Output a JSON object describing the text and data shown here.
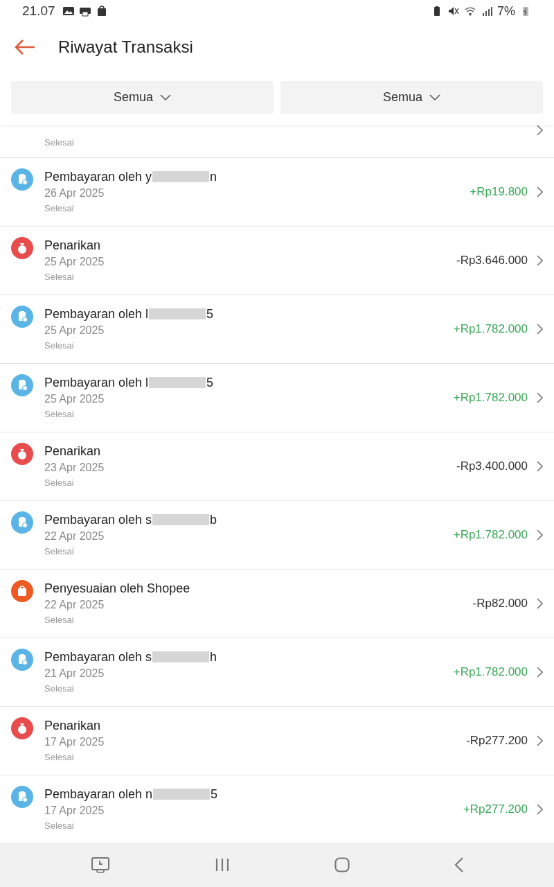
{
  "status_bar": {
    "time": "21.07",
    "battery": "7%"
  },
  "header": {
    "title": "Riwayat Transaksi"
  },
  "filters": [
    {
      "label": "Semua"
    },
    {
      "label": "Semua"
    }
  ],
  "partial_row": {
    "status": "Selesai"
  },
  "transactions": [
    {
      "kind": "payment",
      "title": "Pembayaran oleh y",
      "redacted": true,
      "title_end": "n",
      "date": "26 Apr 2025",
      "status": "Selesai",
      "amount": "+Rp19.800",
      "credit": true
    },
    {
      "kind": "withdrawal",
      "title": "Penarikan",
      "redacted": false,
      "date": "25 Apr 2025",
      "status": "Selesai",
      "amount": "-Rp3.646.000",
      "credit": false
    },
    {
      "kind": "payment",
      "title": "Pembayaran oleh l",
      "redacted": true,
      "title_end": "5",
      "date": "25 Apr 2025",
      "status": "Selesai",
      "amount": "+Rp1.782.000",
      "credit": true
    },
    {
      "kind": "payment",
      "title": "Pembayaran oleh l",
      "redacted": true,
      "title_end": "5",
      "date": "25 Apr 2025",
      "status": "Selesai",
      "amount": "+Rp1.782.000",
      "credit": true
    },
    {
      "kind": "withdrawal",
      "title": "Penarikan",
      "redacted": false,
      "date": "23 Apr 2025",
      "status": "Selesai",
      "amount": "-Rp3.400.000",
      "credit": false
    },
    {
      "kind": "payment",
      "title": "Pembayaran oleh s",
      "redacted": true,
      "title_end": "b",
      "date": "22 Apr 2025",
      "status": "Selesai",
      "amount": "+Rp1.782.000",
      "credit": true
    },
    {
      "kind": "adjustment",
      "title": "Penyesuaian oleh Shopee",
      "redacted": false,
      "date": "22 Apr 2025",
      "status": "Selesai",
      "amount": "-Rp82.000",
      "credit": false
    },
    {
      "kind": "payment",
      "title": "Pembayaran oleh s",
      "redacted": true,
      "title_end": "h",
      "date": "21 Apr 2025",
      "status": "Selesai",
      "amount": "+Rp1.782.000",
      "credit": true
    },
    {
      "kind": "withdrawal",
      "title": "Penarikan",
      "redacted": false,
      "date": "17 Apr 2025",
      "status": "Selesai",
      "amount": "-Rp277.200",
      "credit": false
    },
    {
      "kind": "payment",
      "title": "Pembayaran oleh n",
      "redacted": true,
      "title_end": "5",
      "date": "17 Apr 2025",
      "status": "Selesai",
      "amount": "+Rp277.200",
      "credit": true
    }
  ]
}
